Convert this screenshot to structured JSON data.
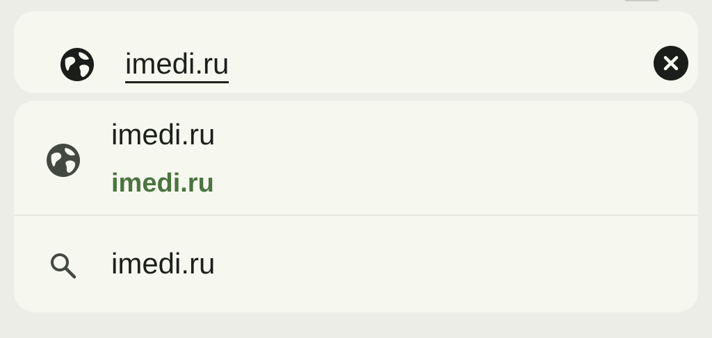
{
  "url_bar": {
    "text": "imedi.ru",
    "left_icon": "globe-icon",
    "clear_icon": "close-icon"
  },
  "suggestions": [
    {
      "title": "imedi.ru",
      "subtitle": "imedi.ru",
      "icon": "globe-icon"
    },
    {
      "title": "imedi.ru",
      "icon": "search-icon"
    }
  ],
  "colors": {
    "background": "#ebede6",
    "surface": "#f6f8f0",
    "text": "#1d1f1c",
    "url_green": "#4b7440",
    "icon_dark": "#1b1d1a",
    "icon_muted": "#434840"
  }
}
